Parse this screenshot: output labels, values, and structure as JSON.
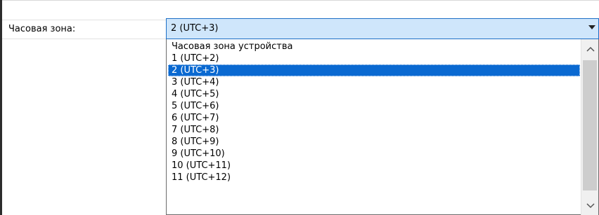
{
  "field": {
    "label": "Часовая зона:",
    "selected_value": "2 (UTC+3)"
  },
  "dropdown": {
    "options": [
      "Часовая зона устройства",
      "1 (UTC+2)",
      "2 (UTC+3)",
      "3 (UTC+4)",
      "4 (UTC+5)",
      "5 (UTC+6)",
      "6 (UTC+7)",
      "7 (UTC+8)",
      "8 (UTC+9)",
      "9 (UTC+10)",
      "10 (UTC+11)",
      "11 (UTC+12)"
    ],
    "selected_index": 2
  },
  "colors": {
    "selection": "#0a69d1",
    "combo_background": "#cfe6fb",
    "combo_border": "#1e6fc6"
  },
  "icons": {
    "scroll_up": "chevron-up-icon",
    "scroll_down": "chevron-down-icon",
    "select_arrow": "triangle-down-icon"
  }
}
